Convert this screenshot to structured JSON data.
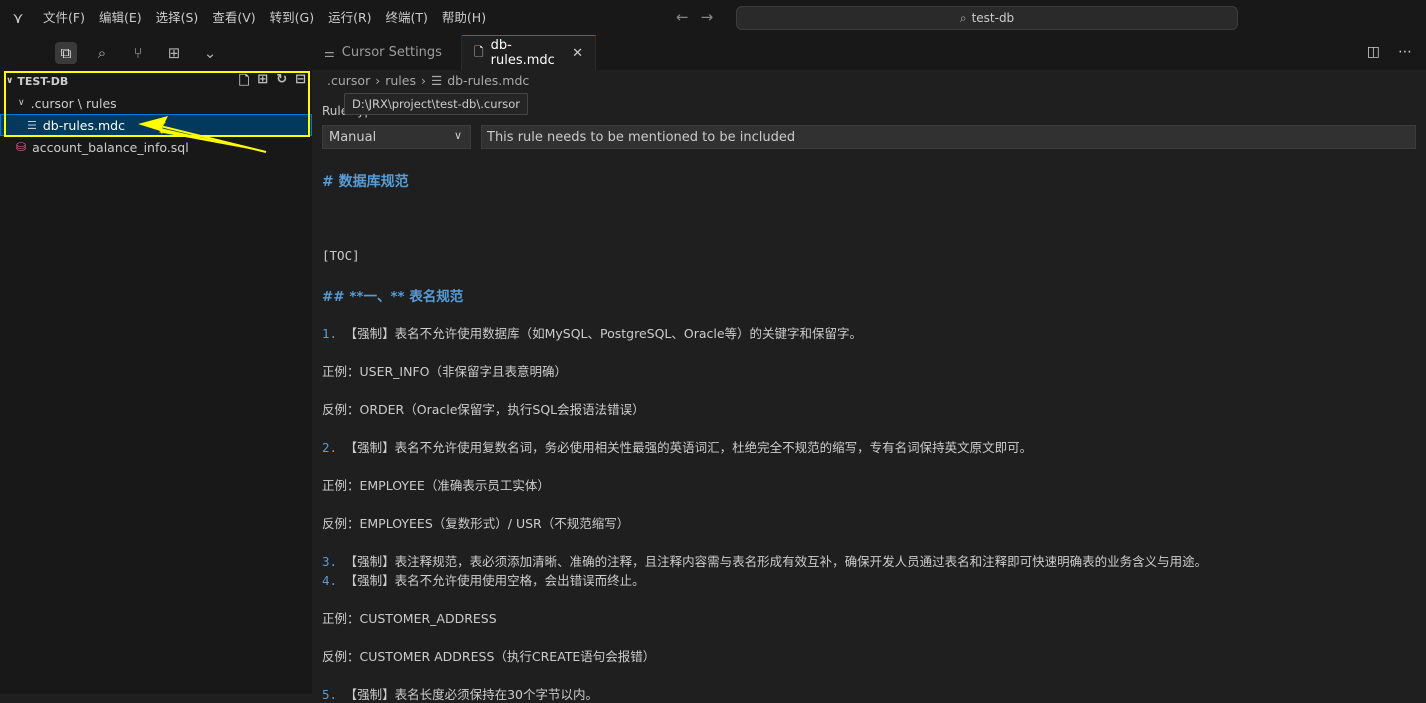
{
  "menu": [
    "文件(F)",
    "编辑(E)",
    "选择(S)",
    "查看(V)",
    "转到(G)",
    "运行(R)",
    "终端(T)",
    "帮助(H)"
  ],
  "search": {
    "text": "test-db"
  },
  "explorer": {
    "root": "TEST-DB",
    "folder": ".cursor \\ rules",
    "selected_file": "db-rules.mdc",
    "other_file": "account_balance_info.sql"
  },
  "tabs": [
    {
      "label": "Cursor Settings",
      "active": false
    },
    {
      "label": "db-rules.mdc",
      "active": true
    }
  ],
  "breadcrumb": [
    ".cursor",
    "rules",
    "db-rules.mdc"
  ],
  "tooltip": "D:\\JRX\\project\\test-db\\.cursor",
  "rule": {
    "label": "Rule Type",
    "type": "Manual",
    "description": "This rule needs to be mentioned to be included"
  },
  "document": {
    "h1": "# 数据库规范",
    "toc": "[TOC]",
    "h2": "## **一、** 表名规范",
    "item1": "【强制】表名不允许使用数据库（如MySQL、PostgreSQL、Oracle等）的关键字和保留字。",
    "ex1_ok": "正例：USER_INFO（非保留字且表意明确）",
    "ex1_bad": "反例：ORDER（Oracle保留字，执行SQL会报语法错误）",
    "item2": "【强制】表名不允许使用复数名词，务必使用相关性最强的英语词汇，杜绝完全不规范的缩写，专有名词保持英文原文即可。",
    "ex2_ok": "正例：EMPLOYEE（准确表示员工实体）",
    "ex2_bad": "反例：EMPLOYEES（复数形式）/ USR（不规范缩写）",
    "item3": "【强制】表注释规范，表必须添加清晰、准确的注释，且注释内容需与表名形成有效互补，确保开发人员通过表名和注释即可快速明确表的业务含义与用途。",
    "item4": "【强制】表名不允许使用使用空格，会出错误而终止。",
    "ex4_ok": "正例：CUSTOMER_ADDRESS",
    "ex4_bad": "反例：CUSTOMER ADDRESS（执行CREATE语句会报错）",
    "item5": "【强制】表名长度必须保持在30个字节以内。"
  }
}
